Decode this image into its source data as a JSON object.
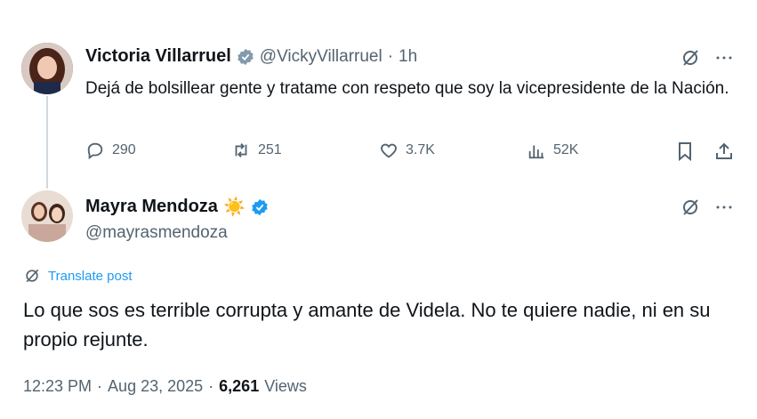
{
  "tweet1": {
    "name": "Victoria Villarruel",
    "handle": "@VickyVillarruel",
    "separator": "·",
    "time": "1h",
    "text": "Dejá de bolsillear gente y tratame con respeto que soy la vicepresidente de la Nación.",
    "replies": "290",
    "retweets": "251",
    "likes": "3.7K",
    "views": "52K"
  },
  "tweet2": {
    "name": "Mayra Mendoza",
    "emoji": "☀️",
    "handle": "@mayrasmendoza",
    "translate": "Translate post",
    "text": "Lo que sos es terrible corrupta y amante de Videla. No te quiere nadie, ni en su propio rejunte.",
    "time": "12:23 PM",
    "date": "Aug 23, 2025",
    "views_count": "6,261",
    "views_label": "Views",
    "dot": "·"
  },
  "colors": {
    "accent": "#1d9bf0",
    "muted": "#536471",
    "text": "#0f1419"
  }
}
